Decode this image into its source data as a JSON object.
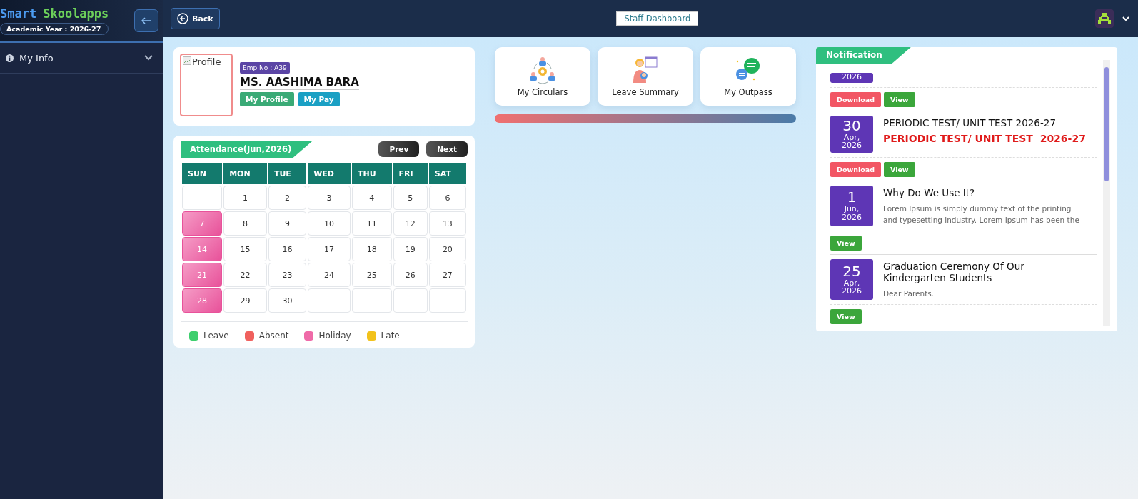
{
  "sidebar": {
    "brand_first": "Smart",
    "brand_second": "Skoolapps",
    "academic_year": "Academic Year : 2026-27",
    "items": [
      {
        "label": "My Info",
        "expanded": false
      }
    ]
  },
  "topbar": {
    "back": "Back",
    "title": "Staff Dashboard"
  },
  "profile": {
    "image_alt": "Profile",
    "emp_no": "Emp No : A39",
    "name": "MS. AASHIMA BARA",
    "buttons": [
      {
        "label": "My Profile",
        "kind": "profile"
      },
      {
        "label": "My Pay",
        "kind": "pay"
      }
    ]
  },
  "attendance": {
    "title": "Attendance(Jun,2026)",
    "prev": "Prev",
    "next": "Next",
    "weekdays": [
      "SUN",
      "MON",
      "TUE",
      "WED",
      "THU",
      "FRI",
      "SAT"
    ],
    "weeks": [
      [
        {
          "kind": "blank"
        },
        {
          "kind": "day",
          "day": "1",
          "holiday": false
        },
        {
          "kind": "day",
          "day": "2",
          "holiday": false
        },
        {
          "kind": "day",
          "day": "3",
          "holiday": false
        },
        {
          "kind": "day",
          "day": "4",
          "holiday": false
        },
        {
          "kind": "day",
          "day": "5",
          "holiday": false
        },
        {
          "kind": "day",
          "day": "6",
          "holiday": false
        }
      ],
      [
        {
          "kind": "day",
          "day": "7",
          "holiday": true
        },
        {
          "kind": "day",
          "day": "8",
          "holiday": false
        },
        {
          "kind": "day",
          "day": "9",
          "holiday": false
        },
        {
          "kind": "day",
          "day": "10",
          "holiday": false
        },
        {
          "kind": "day",
          "day": "11",
          "holiday": false
        },
        {
          "kind": "day",
          "day": "12",
          "holiday": false
        },
        {
          "kind": "day",
          "day": "13",
          "holiday": false
        }
      ],
      [
        {
          "kind": "day",
          "day": "14",
          "holiday": true
        },
        {
          "kind": "day",
          "day": "15",
          "holiday": false
        },
        {
          "kind": "day",
          "day": "16",
          "holiday": false
        },
        {
          "kind": "day",
          "day": "17",
          "holiday": false
        },
        {
          "kind": "day",
          "day": "18",
          "holiday": false
        },
        {
          "kind": "day",
          "day": "19",
          "holiday": false
        },
        {
          "kind": "day",
          "day": "20",
          "holiday": false
        }
      ],
      [
        {
          "kind": "day",
          "day": "21",
          "holiday": true
        },
        {
          "kind": "day",
          "day": "22",
          "holiday": false
        },
        {
          "kind": "day",
          "day": "23",
          "holiday": false
        },
        {
          "kind": "day",
          "day": "24",
          "holiday": false
        },
        {
          "kind": "day",
          "day": "25",
          "holiday": false
        },
        {
          "kind": "day",
          "day": "26",
          "holiday": false
        },
        {
          "kind": "day",
          "day": "27",
          "holiday": false
        }
      ],
      [
        {
          "kind": "day",
          "day": "28",
          "holiday": true
        },
        {
          "kind": "day",
          "day": "29",
          "holiday": false
        },
        {
          "kind": "day",
          "day": "30",
          "holiday": false
        },
        {
          "kind": "blank"
        },
        {
          "kind": "blank"
        },
        {
          "kind": "blank"
        },
        {
          "kind": "blank"
        }
      ]
    ],
    "legend": [
      {
        "label": "Leave",
        "color": "#3ecf6e"
      },
      {
        "label": "Absent",
        "color": "#f0605d"
      },
      {
        "label": "Holiday",
        "color": "#ef6aa8"
      },
      {
        "label": "Late",
        "color": "#f2c21b"
      }
    ]
  },
  "quick_links": [
    {
      "label": "My Circulars",
      "kind": "circulars"
    },
    {
      "label": "Leave Summary",
      "kind": "leave"
    },
    {
      "label": "My Outpass",
      "kind": "outpass"
    }
  ],
  "notification": {
    "title": "Notification",
    "items": [
      {
        "year": "2026",
        "buttons": [
          {
            "label": "Download",
            "kind": "download"
          },
          {
            "label": "View",
            "kind": "view"
          }
        ]
      },
      {
        "day": "30",
        "month": "Apr,",
        "year": "2026",
        "title": "PERIODIC TEST/ UNIT TEST 2026-27",
        "subtitle": "PERIODIC TEST/ UNIT TEST  2026-27",
        "buttons": [
          {
            "label": "Download",
            "kind": "download"
          },
          {
            "label": "View",
            "kind": "view"
          }
        ]
      },
      {
        "day": "1",
        "month": "Jun,",
        "year": "2026",
        "title": "Why Do We Use It?",
        "description": "Lorem Ipsum is simply dummy text of the printing and typesetting industry. Lorem Ipsum has been the",
        "buttons": [
          {
            "label": "View",
            "kind": "view"
          }
        ]
      },
      {
        "day": "25",
        "month": "Apr,",
        "year": "2026",
        "title": "Graduation Ceremony Of Our Kindergarten Students",
        "description": "Dear Parents.",
        "buttons": [
          {
            "label": "View",
            "kind": "view"
          }
        ]
      }
    ]
  }
}
